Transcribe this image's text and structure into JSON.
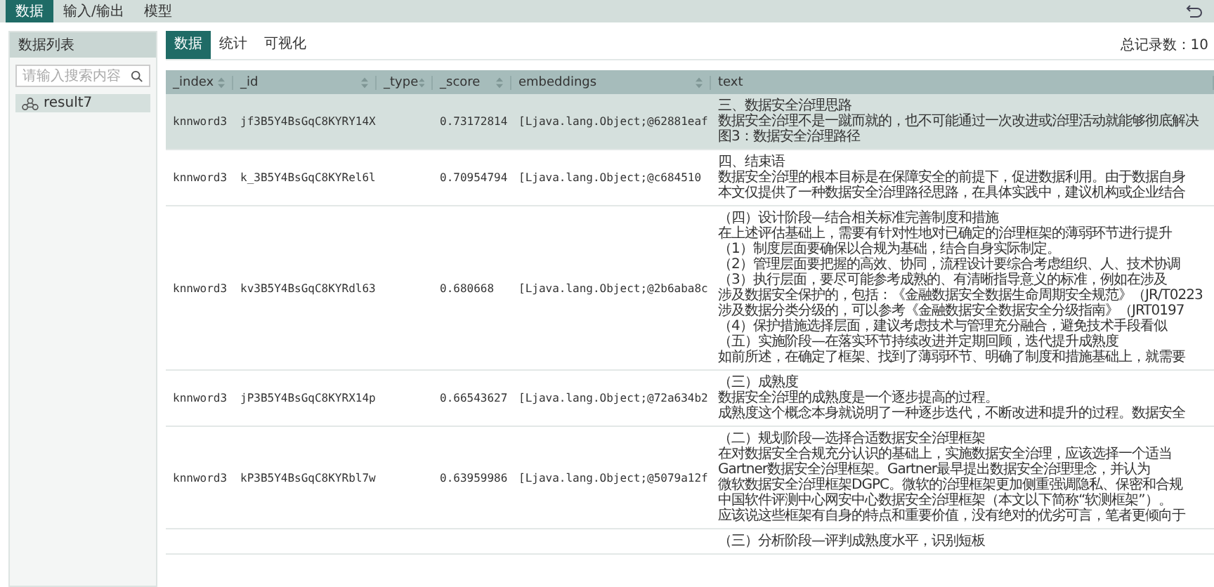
{
  "menu": [
    {
      "label": "数据",
      "selected": true
    },
    {
      "label": "输入/输出",
      "selected": false
    },
    {
      "label": "模型",
      "selected": false
    }
  ],
  "sidebar": {
    "title": "数据列表",
    "search": {
      "placeholder": "请输入搜索内容"
    },
    "items": [
      {
        "label": "result7",
        "selected": true
      }
    ]
  },
  "tabs": [
    {
      "label": "数据",
      "selected": true
    },
    {
      "label": "统计",
      "selected": false
    },
    {
      "label": "可视化",
      "selected": false
    }
  ],
  "total": "总记录数：10",
  "table": {
    "columns": [
      {
        "label": "_index",
        "sortable": true
      },
      {
        "label": "_id",
        "sortable": true
      },
      {
        "label": "_type",
        "sortable": true
      },
      {
        "label": "_score",
        "sortable": true
      },
      {
        "label": "embeddings",
        "sortable": true
      },
      {
        "label": "text",
        "sortable": false
      }
    ],
    "rows": [
      {
        "selected": true,
        "cells": [
          "knnword3",
          "jf3B5Y4BsGqC8KYRY14X",
          "",
          "0.73172814",
          "[Ljava.lang.Object;@62881eaf"
        ],
        "text": [
          "三、数据安全治理思路",
          "数据安全治理不是一蹴而就的，也不可能通过一次改进或治理活动就能够彻底解决",
          "图3：数据安全治理路径"
        ]
      },
      {
        "selected": false,
        "cells": [
          "knnword3",
          "k_3B5Y4BsGqC8KYRel6l",
          "",
          "0.70954794",
          "[Ljava.lang.Object;@c684510"
        ],
        "text": [
          "四、结束语",
          "数据安全治理的根本目标是在保障安全的前提下，促进数据利用。由于数据自身",
          "本文仅提供了一种数据安全治理路径思路，在具体实践中，建议机构或企业结合"
        ]
      },
      {
        "selected": false,
        "cells": [
          "knnword3",
          "kv3B5Y4BsGqC8KYRdl63",
          "",
          "0.680668",
          "[Ljava.lang.Object;@2b6aba8c"
        ],
        "text": [
          "（四）设计阶段—结合相关标准完善制度和措施",
          "在上述评估基础上，需要有针对性地对已确定的治理框架的薄弱环节进行提升",
          "（1）制度层面要确保以合规为基础，结合自身实际制定。",
          "（2）管理层面要把握的高效、协同，流程设计要综合考虑组织、人、技术协调",
          "（3）执行层面，要尽可能参考成熟的、有清晰指导意义的标准，例如在涉及",
          "涉及数据安全保护的，包括：《金融数据安全数据生命周期安全规范》（JR/T0223",
          "涉及数据分类分级的，可以参考《金融数据安全数据安全分级指南》（JRT0197",
          "（4）保护措施选择层面，建议考虑技术与管理充分融合，避免技术手段看似",
          "（五）实施阶段—在落实环节持续改进并定期回顾，迭代提升成熟度",
          "如前所述，在确定了框架、找到了薄弱环节、明确了制度和措施基础上，就需要"
        ]
      },
      {
        "selected": false,
        "cells": [
          "knnword3",
          "jP3B5Y4BsGqC8KYRX14p",
          "",
          "0.66543627",
          "[Ljava.lang.Object;@72a634b2"
        ],
        "text": [
          "（三）成熟度",
          "数据安全治理的成熟度是一个逐步提高的过程。",
          "成熟度这个概念本身就说明了一种逐步迭代，不断改进和提升的过程。数据安全"
        ]
      },
      {
        "selected": false,
        "cells": [
          "knnword3",
          "kP3B5Y4BsGqC8KYRbl7w",
          "",
          "0.63959986",
          "[Ljava.lang.Object;@5079a12f"
        ],
        "text": [
          "（二）规划阶段—选择合适数据安全治理框架",
          "在对数据安全合规充分认识的基础上，实施数据安全治理，应该选择一个适当",
          "Gartner数据安全治理框架。Gartner最早提出数据安全治理理念，并认为",
          "微软数据安全治理框架DGPC。微软的治理框架更加侧重强调隐私、保密和合规",
          "中国软件评测中心网安中心数据安全治理框架（本文以下简称“软测框架”）。",
          "应该说这些框架有自身的特点和重要价值，没有绝对的优劣可言，笔者更倾向于"
        ]
      },
      {
        "selected": false,
        "cells": [
          "",
          "",
          "",
          "",
          ""
        ],
        "text": [
          "（三）分析阶段—评判成熟度水平，识别短板"
        ]
      }
    ]
  }
}
